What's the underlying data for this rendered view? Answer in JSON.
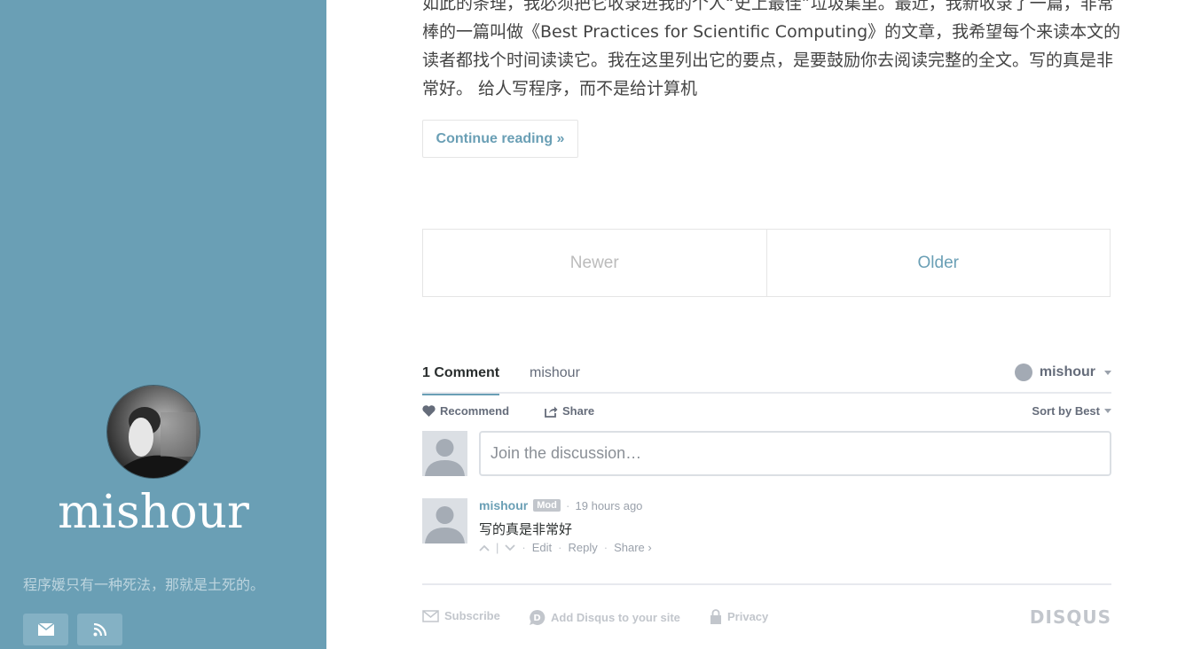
{
  "sidebar": {
    "title": "mishour",
    "tagline": "程序媛只有一种死法，那就是土死的。",
    "social": [
      "envelope-icon",
      "rss-icon"
    ]
  },
  "post": {
    "excerpt": "如此的条理，我必须把它收录进我的个人“史上最佳”垃圾集里。最近，我新收录了一篇，非常棒的一篇叫做《Best Practices for Scientific Computing》的文章，我希望每个来读本文的读者都找个时间读读它。我在这里列出它的要点，是要鼓励你去阅读完整的全文。写的真是非常好。 给人写程序，而不是给计算机",
    "continue_label": "Continue reading »"
  },
  "pager": {
    "newer": "Newer",
    "older": "Older"
  },
  "disqus": {
    "comment_count": "1 Comment",
    "site_tab": "mishour",
    "user": "mishour",
    "recommend": "Recommend",
    "share": "Share",
    "sort": "Sort by Best",
    "placeholder": "Join the discussion…",
    "comments": [
      {
        "author": "mishour",
        "badge": "Mod",
        "time": "19 hours ago",
        "body": "写的真是非常好",
        "edit": "Edit",
        "reply": "Reply",
        "share": "Share ›"
      }
    ],
    "footer": {
      "subscribe": "Subscribe",
      "add_disqus": "Add Disqus to your site",
      "privacy": "Privacy",
      "logo": "DISQUS"
    }
  },
  "colors": {
    "sidebar": "#6a9fb5",
    "accent": "#6a9fb5"
  }
}
